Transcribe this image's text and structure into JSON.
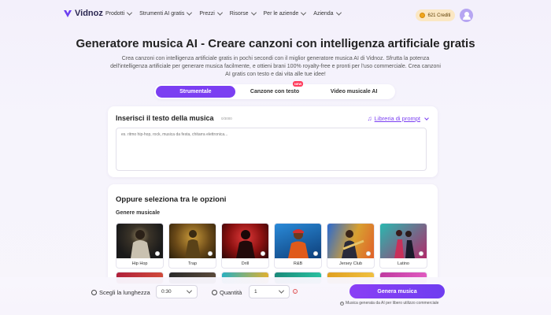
{
  "brand": {
    "name": "Vidnoz"
  },
  "nav": {
    "items": [
      {
        "label": "Prodotti"
      },
      {
        "label": "Strumenti AI gratis"
      },
      {
        "label": "Prezzi"
      },
      {
        "label": "Risorse"
      },
      {
        "label": "Per le aziende"
      },
      {
        "label": "Azienda"
      }
    ],
    "credits": "621 Crediti"
  },
  "hero": {
    "title": "Generatore musica AI - Creare canzoni con intelligenza artificiale gratis",
    "subtitle": "Crea canzoni con intelligenza artificiale gratis in pochi secondi con il miglior generatore musica AI di Vidnoz. Sfrutta la potenza dell'intelligenza artificiale per generare musica facilmente, e ottieni brani 100% royalty-free e pronti per l'uso commerciale. Crea canzoni AI gratis con testo e dai vita alle tue idee!"
  },
  "tabs": [
    {
      "label": "Strumentale",
      "active": true
    },
    {
      "label": "Canzone con testo",
      "badge": "NEW"
    },
    {
      "label": "Video musicale AI"
    }
  ],
  "lyrics": {
    "title": "Inserisci il testo della musica",
    "counter": "0/3000",
    "prompt_library": "Libreria di prompt",
    "placeholder": "es. ritmo hip-hop, rock, musica da festa, chitarra elettronica..."
  },
  "options": {
    "title": "Oppure seleziona tra le opzioni",
    "genre_heading": "Genere musicale",
    "genres": [
      {
        "label": "Hip Hop",
        "color": "#3a3a3a"
      },
      {
        "label": "Trap",
        "color": "#8a6a2a"
      },
      {
        "label": "Drill",
        "color": "#a52020"
      },
      {
        "label": "R&B",
        "color": "#1e6fb8"
      },
      {
        "label": "Jersey Club",
        "color": "#d98a2a"
      },
      {
        "label": "Latino",
        "color": "#2aa6a0"
      }
    ]
  },
  "footer": {
    "length_label": "Scegli la lunghezza",
    "length_value": "0:30",
    "qty_label": "Quantità",
    "qty_value": "1",
    "generate_label": "Genera musica",
    "note": "Musica generata da AI per libero utilizzo commerciale"
  },
  "colors": {
    "accent": "#7b3ff2",
    "credits_bg": "#fbe7c3"
  }
}
